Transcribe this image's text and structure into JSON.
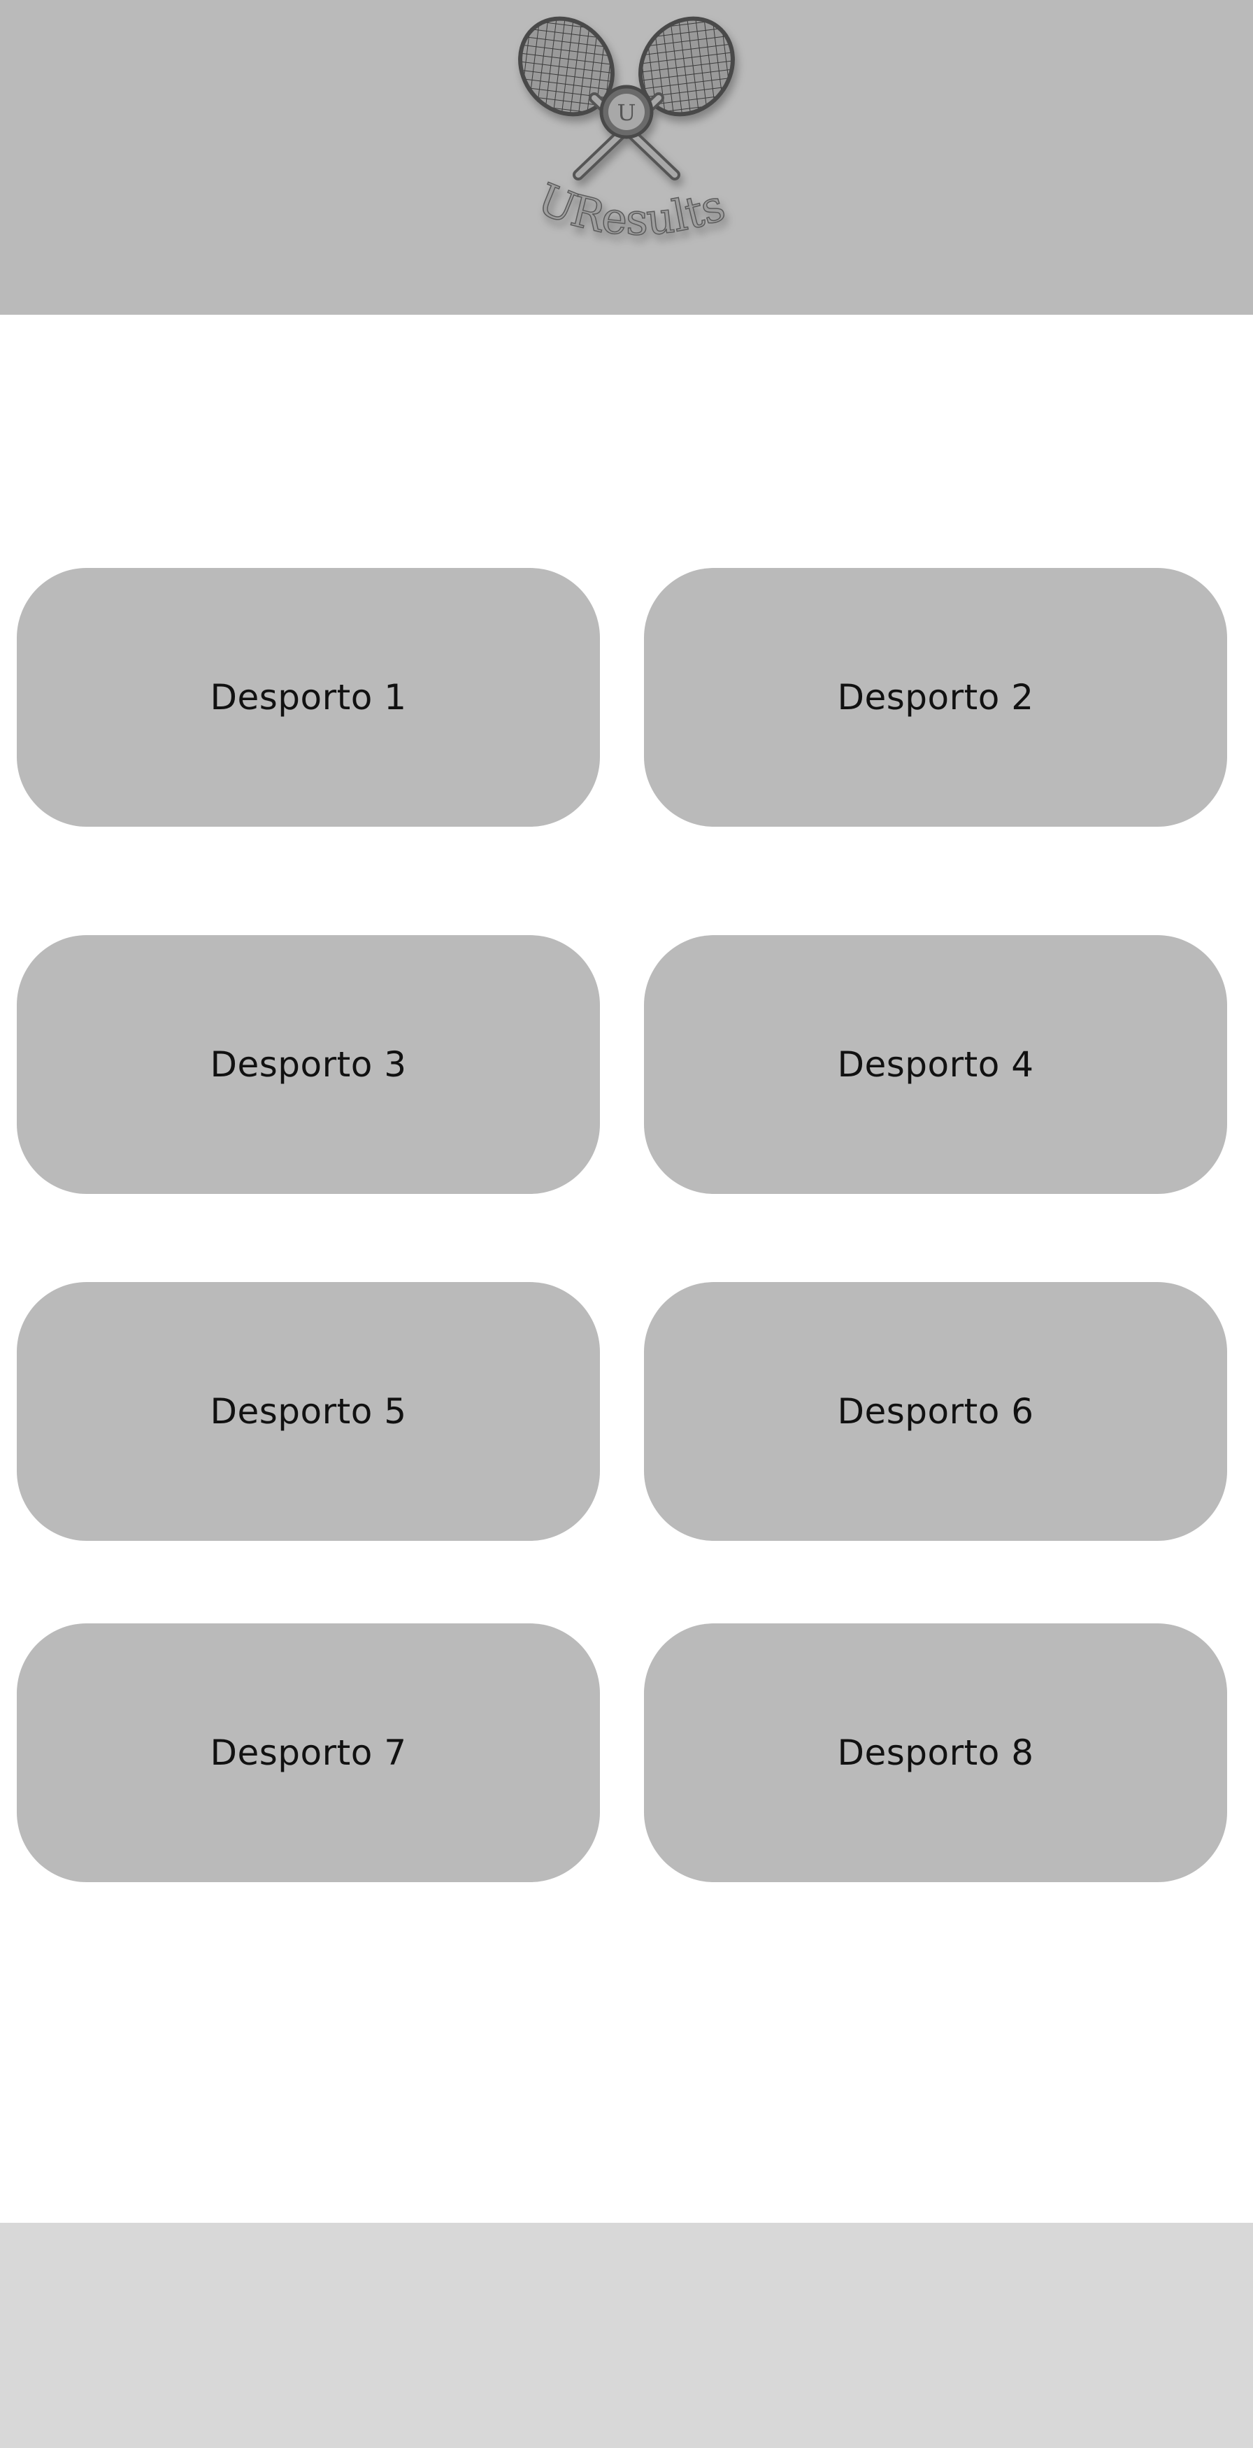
{
  "header": {
    "logo_text": "UResults",
    "logo_badge": "U",
    "logo_icon": "crossed-tennis-rackets-icon"
  },
  "sports": [
    {
      "label": "Desporto 1"
    },
    {
      "label": "Desporto 2"
    },
    {
      "label": "Desporto 3"
    },
    {
      "label": "Desporto 4"
    },
    {
      "label": "Desporto 5"
    },
    {
      "label": "Desporto 6"
    },
    {
      "label": "Desporto 7"
    },
    {
      "label": "Desporto 8"
    }
  ],
  "colors": {
    "header_bg": "#bababa",
    "button_bg": "#bababa",
    "footer_bg": "#d8d8d8",
    "page_bg": "#ffffff",
    "text": "#111111"
  }
}
